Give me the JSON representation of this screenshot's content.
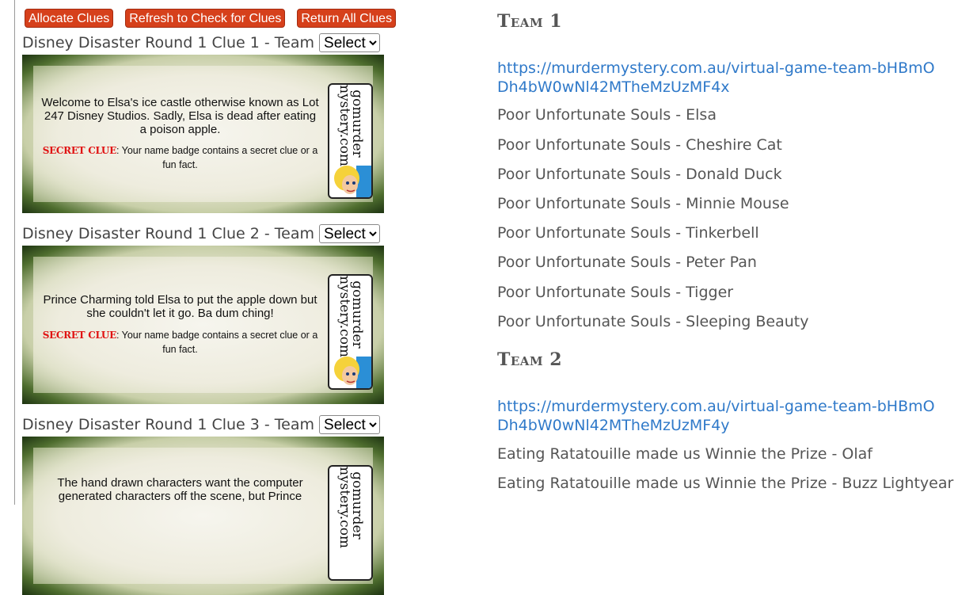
{
  "buttons": {
    "allocate": "Allocate Clues",
    "refresh": "Refresh to Check for Clues",
    "return_all": "Return All Clues"
  },
  "clues": [
    {
      "label": "Disney Disaster Round 1 Clue 1 - Team",
      "select_value": "Select",
      "text": "Welcome to Elsa's ice castle otherwise known as Lot 247 Disney Studios. Sadly, Elsa is dead after eating a poison apple.",
      "secret_tag": "SECRET CLUE",
      "secret_text": ": Your name badge contains a secret clue or a fun fact."
    },
    {
      "label": "Disney Disaster Round 1 Clue 2 - Team",
      "select_value": "Select",
      "text": "Prince Charming told Elsa to put the apple down but she couldn't let it go. Ba dum ching!",
      "secret_tag": "SECRET CLUE",
      "secret_text": ": Your name badge contains a secret clue or a fun fact."
    },
    {
      "label": "Disney Disaster Round 1 Clue 3 - Team",
      "select_value": "Select",
      "text": "The hand drawn characters want the computer generated characters off the scene, but Prince",
      "secret_tag": "",
      "secret_text": ""
    }
  ],
  "card_logo": {
    "line1": "gomurder",
    "line2": "mystery.com"
  },
  "teams": [
    {
      "heading": "Team 1",
      "link": "https://murdermystery.com.au/virtual-game-team-bHBmODh4bW0wNl42MTheMzUzMF4x",
      "members": [
        "Poor Unfortunate Souls - Elsa",
        "Poor Unfortunate Souls - Cheshire Cat",
        "Poor Unfortunate Souls - Donald Duck",
        "Poor Unfortunate Souls - Minnie Mouse",
        "Poor Unfortunate Souls - Tinkerbell",
        "Poor Unfortunate Souls - Peter Pan",
        "Poor Unfortunate Souls - Tigger",
        "Poor Unfortunate Souls - Sleeping Beauty"
      ]
    },
    {
      "heading": "Team 2",
      "link": "https://murdermystery.com.au/virtual-game-team-bHBmODh4bW0wNl42MTheMzUzMF4y",
      "members": [
        "Eating Ratatouille made us Winnie the Prize - Olaf",
        "Eating Ratatouille made us Winnie the Prize - Buzz Lightyear"
      ]
    }
  ]
}
